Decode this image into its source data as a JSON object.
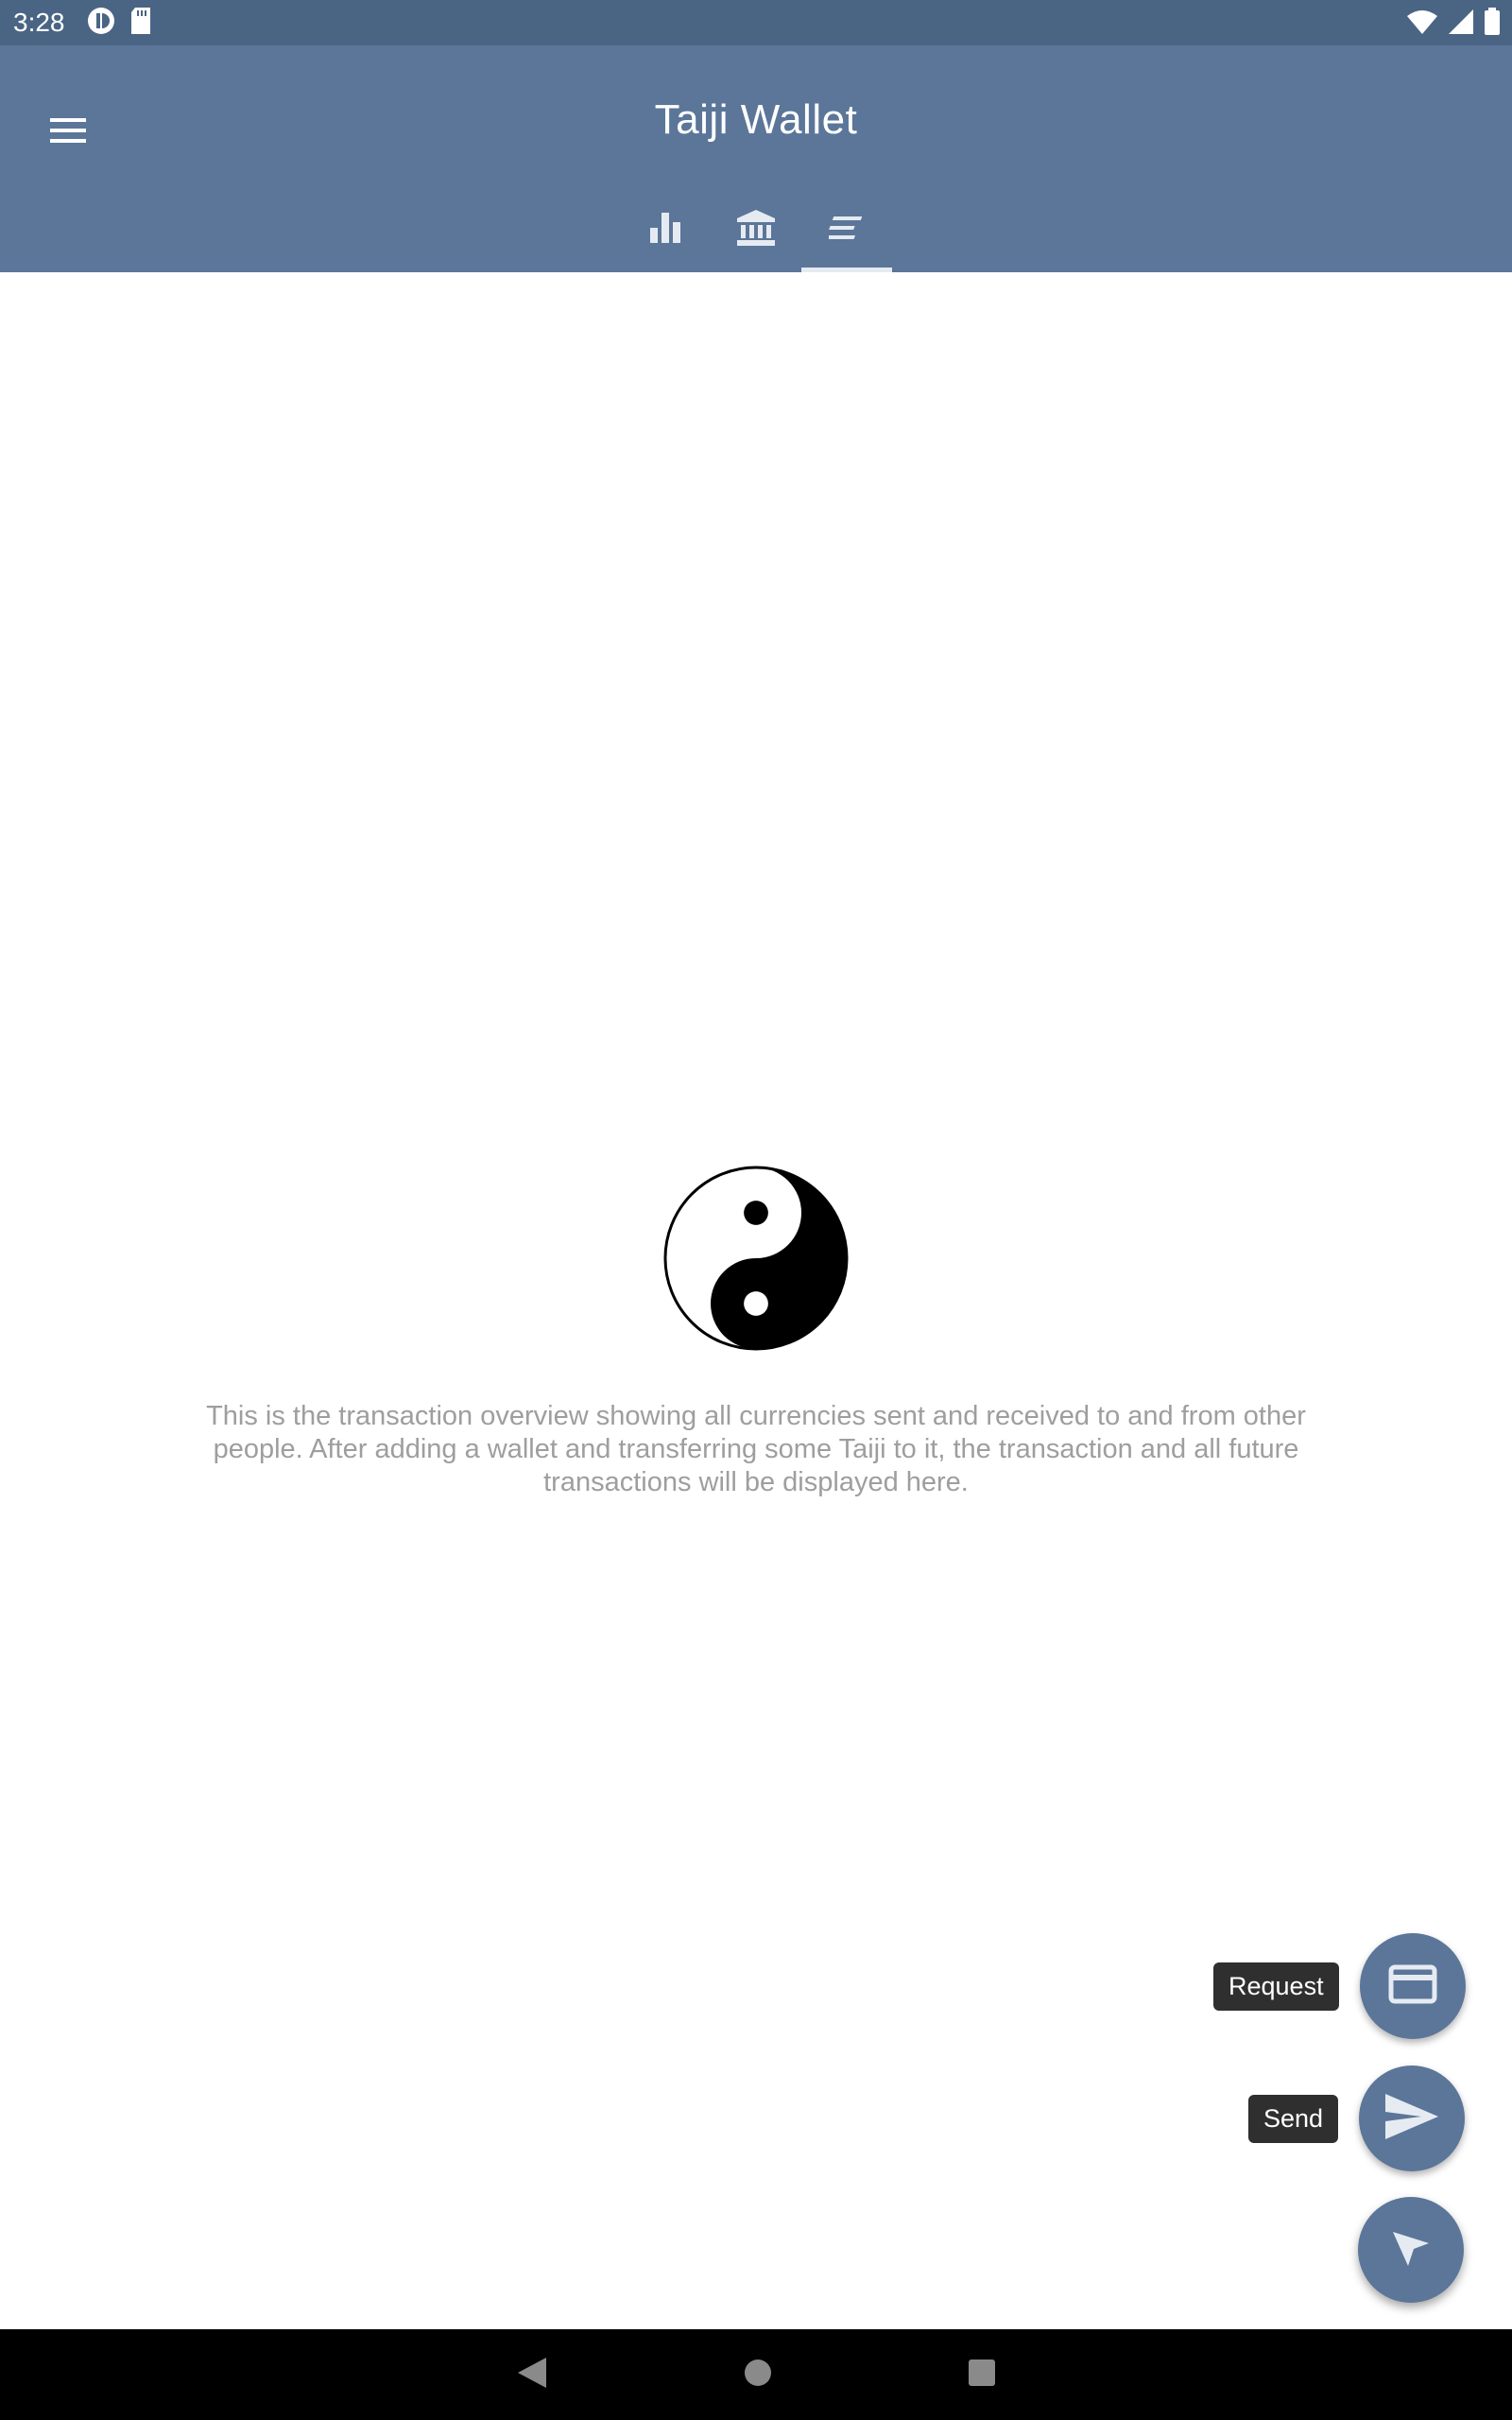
{
  "status_bar": {
    "time": "3:28",
    "left_icons": [
      "circle-app-icon",
      "sd-card-icon"
    ],
    "right_icons": [
      "wifi-icon",
      "signal-icon",
      "battery-icon"
    ]
  },
  "app_bar": {
    "title": "Taiji Wallet",
    "menu_icon": "hamburger-menu-icon",
    "tabs": [
      {
        "icon": "bar-chart-icon",
        "active": false
      },
      {
        "icon": "bank-icon",
        "active": false
      },
      {
        "icon": "transactions-list-icon",
        "active": true
      }
    ]
  },
  "empty_state": {
    "icon": "yin-yang-icon",
    "message": "This is the transaction overview showing all currencies sent and received to and from other people. After adding a wallet and transferring some Taiji to it, the transaction and all future transactions will be displayed here."
  },
  "fab_menu": {
    "request_label": "Request",
    "send_label": "Send",
    "request_icon": "credit-card-icon",
    "send_icon": "send-icon",
    "main_icon": "cursor-arrow-icon"
  },
  "colors": {
    "primary": "#5b7699",
    "status_bar": "#4a6584",
    "text_muted": "#9e9e9e"
  }
}
